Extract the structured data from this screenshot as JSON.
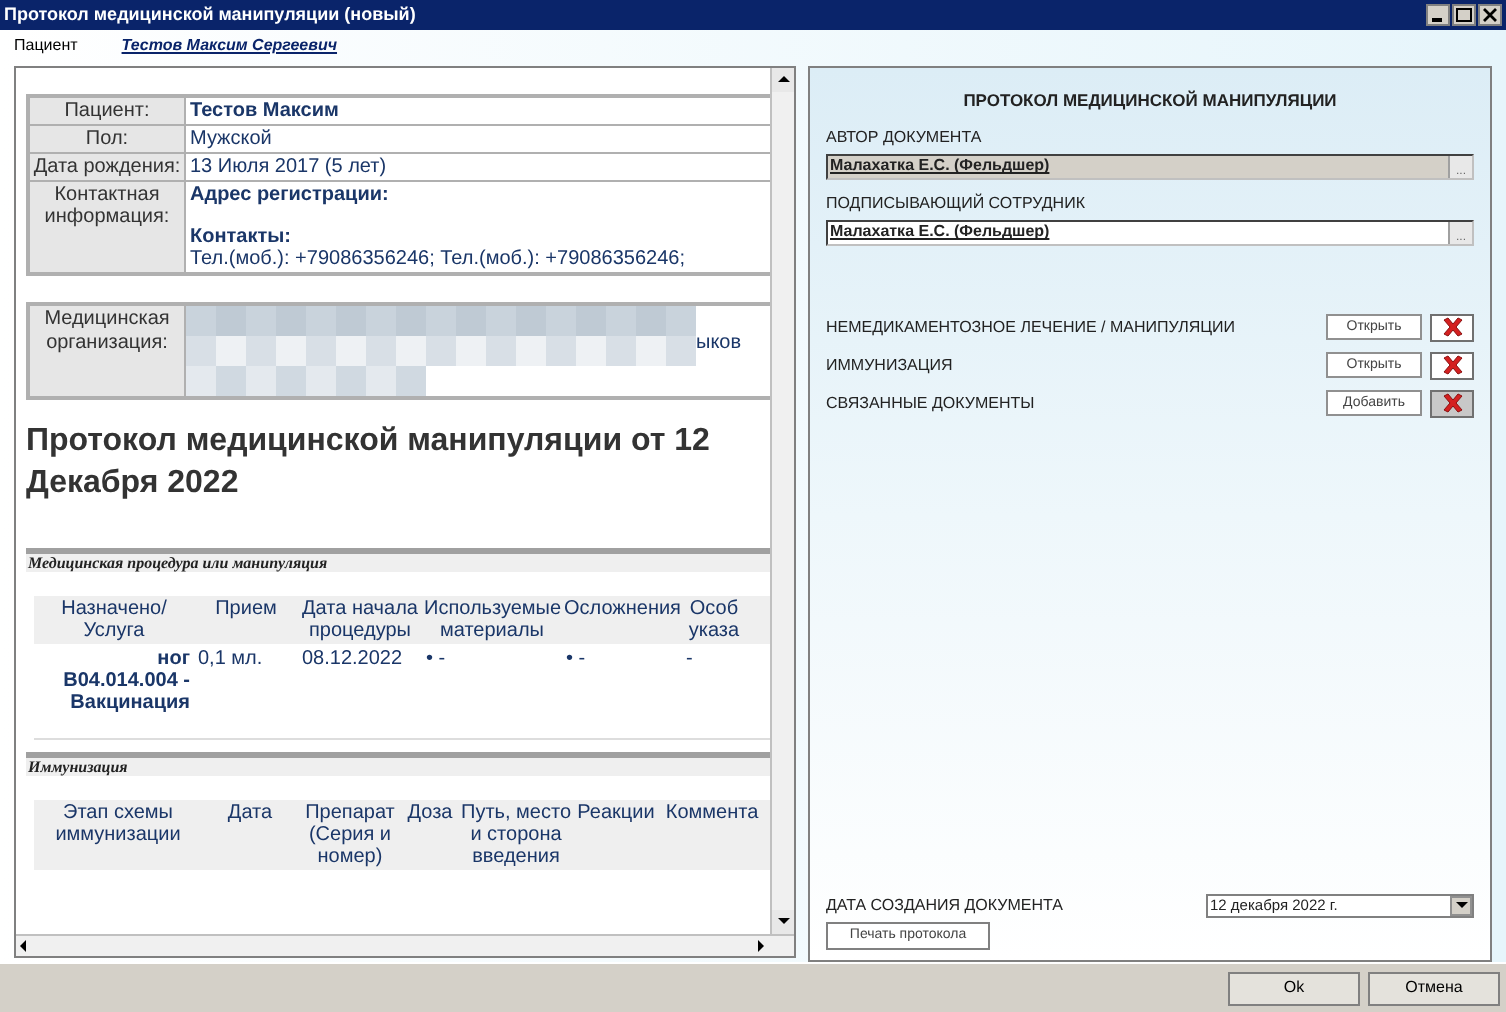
{
  "window": {
    "title": "Протокол медицинской манипуляции (новый)"
  },
  "patient_bar": {
    "label": "Пациент",
    "name": "Тестов Максим Сергеевич"
  },
  "document": {
    "info_rows": [
      {
        "kind": "bold",
        "label": "Пациент:",
        "value": "Тестов Максим"
      },
      {
        "kind": "text",
        "label": "Пол:",
        "value": "Мужской"
      },
      {
        "kind": "text",
        "label": "Дата рождения:",
        "value": "13 Июля 2017 (5 лет)"
      },
      {
        "kind": "contact",
        "label": "Контактная информация:",
        "address_heading": "Адрес регистрации:",
        "contacts_heading": "Контакты:",
        "value": "Тел.(моб.): +79086356246; Тел.(моб.): +79086356246;"
      }
    ],
    "organization": {
      "label": "Медицинская организация:",
      "value": "ыков"
    },
    "heading": "Протокол медицинской манипуляции от 12 Декабря 2022",
    "sections": [
      {
        "title": "Медицинская процедура или манипуляция",
        "columns": [
          "Назначено/Услуга",
          "Прием",
          "Дата начала процедуры",
          "Используемые материалы",
          "Осложнения",
          "Особ указа"
        ],
        "rows": [
          [
            "ног B04.014.004 - Вакцинация",
            "0,1 мл.",
            "08.12.2022",
            "• -",
            "• -",
            "-"
          ]
        ]
      },
      {
        "title": "Иммунизация",
        "columns": [
          "Этап схемы иммунизации",
          "Дата",
          "Препарат (Серия и номер)",
          "Доза",
          "Путь, место и сторона введения",
          "Реакции",
          "Коммента"
        ]
      }
    ]
  },
  "panel": {
    "title": "ПРОТОКОЛ МЕДИЦИНСКОЙ МАНИПУЛЯЦИИ",
    "author": {
      "label": "АВТОР ДОКУМЕНТА",
      "value": "Малахатка Е.С. (Фельдшер)",
      "button": "...",
      "disabled": true
    },
    "signer": {
      "label": "ПОДПИСЫВАЮЩИЙ СОТРУДНИК",
      "value": "Малахатка Е.С. (Фельдшер)",
      "button": "...",
      "disabled": false
    },
    "links": [
      {
        "label": "НЕМЕДИКАМЕНТОЗНОЕ ЛЕЧЕНИЕ / МАНИПУЛЯЦИИ",
        "button": "Открыть",
        "disabled": false
      },
      {
        "label": "ИММУНИЗАЦИЯ",
        "button": "Открыть",
        "disabled": false
      },
      {
        "label": "СВЯЗАННЫЕ ДОКУМЕНТЫ",
        "button": "Добавить",
        "disabled": true
      }
    ],
    "created": {
      "label": "ДАТА СОЗДАНИЯ ДОКУМЕНТА",
      "value": "12 декабря  2022 г."
    },
    "print_button": "Печать протокола"
  },
  "footer": {
    "buttons": [
      "Ok",
      "Отмена"
    ]
  }
}
